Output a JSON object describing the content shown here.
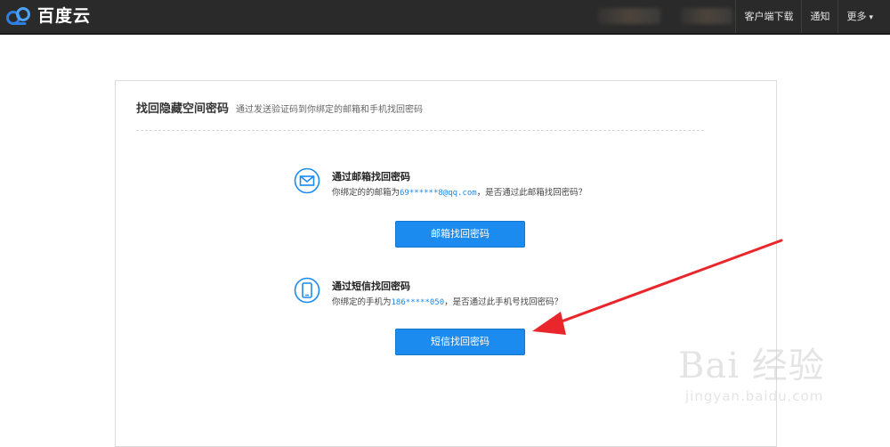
{
  "header": {
    "logo_text": "百度云",
    "nav": [
      {
        "label": "客户端下载"
      },
      {
        "label": "通知"
      },
      {
        "label": "更多"
      }
    ]
  },
  "panel": {
    "title": "找回隐藏空间密码",
    "subtitle": "通过发送验证码到你绑定的邮箱和手机找回密码",
    "email_option": {
      "title": "通过邮箱找回密码",
      "desc_prefix": "你绑定的的邮箱为",
      "desc_value": "69******8@qq.com",
      "desc_suffix": "，是否通过此邮箱找回密码？",
      "button": "邮箱找回密码",
      "icon": "mail-icon"
    },
    "sms_option": {
      "title": "通过短信找回密码",
      "desc_prefix": "你绑定的手机为",
      "desc_value": "186*****050",
      "desc_suffix": "，是否通过此手机号找回密码？",
      "button": "短信找回密码",
      "icon": "phone-icon"
    }
  },
  "watermark": {
    "main": "Bai 经验",
    "sub": "jingyan.baidu.com"
  },
  "colors": {
    "topbar": "#2a2a2a",
    "accent": "#1b8bf0",
    "annotation_arrow": "#e8262b"
  }
}
